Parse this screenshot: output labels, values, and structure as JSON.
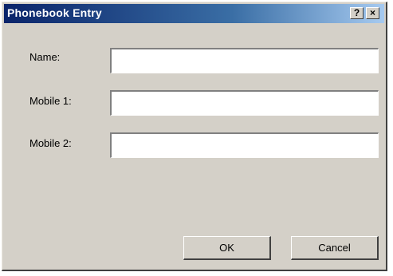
{
  "window": {
    "title": "Phonebook Entry",
    "help_label": "?",
    "close_label": "×"
  },
  "form": {
    "name_label": "Name:",
    "name_value": "",
    "mobile1_label": "Mobile 1:",
    "mobile1_value": "",
    "mobile2_label": "Mobile 2:",
    "mobile2_value": ""
  },
  "buttons": {
    "ok_label": "OK",
    "cancel_label": "Cancel"
  },
  "colors": {
    "titlebar_start": "#0a246a",
    "titlebar_end": "#a6caf0",
    "dialog_bg": "#d4d0c8"
  }
}
